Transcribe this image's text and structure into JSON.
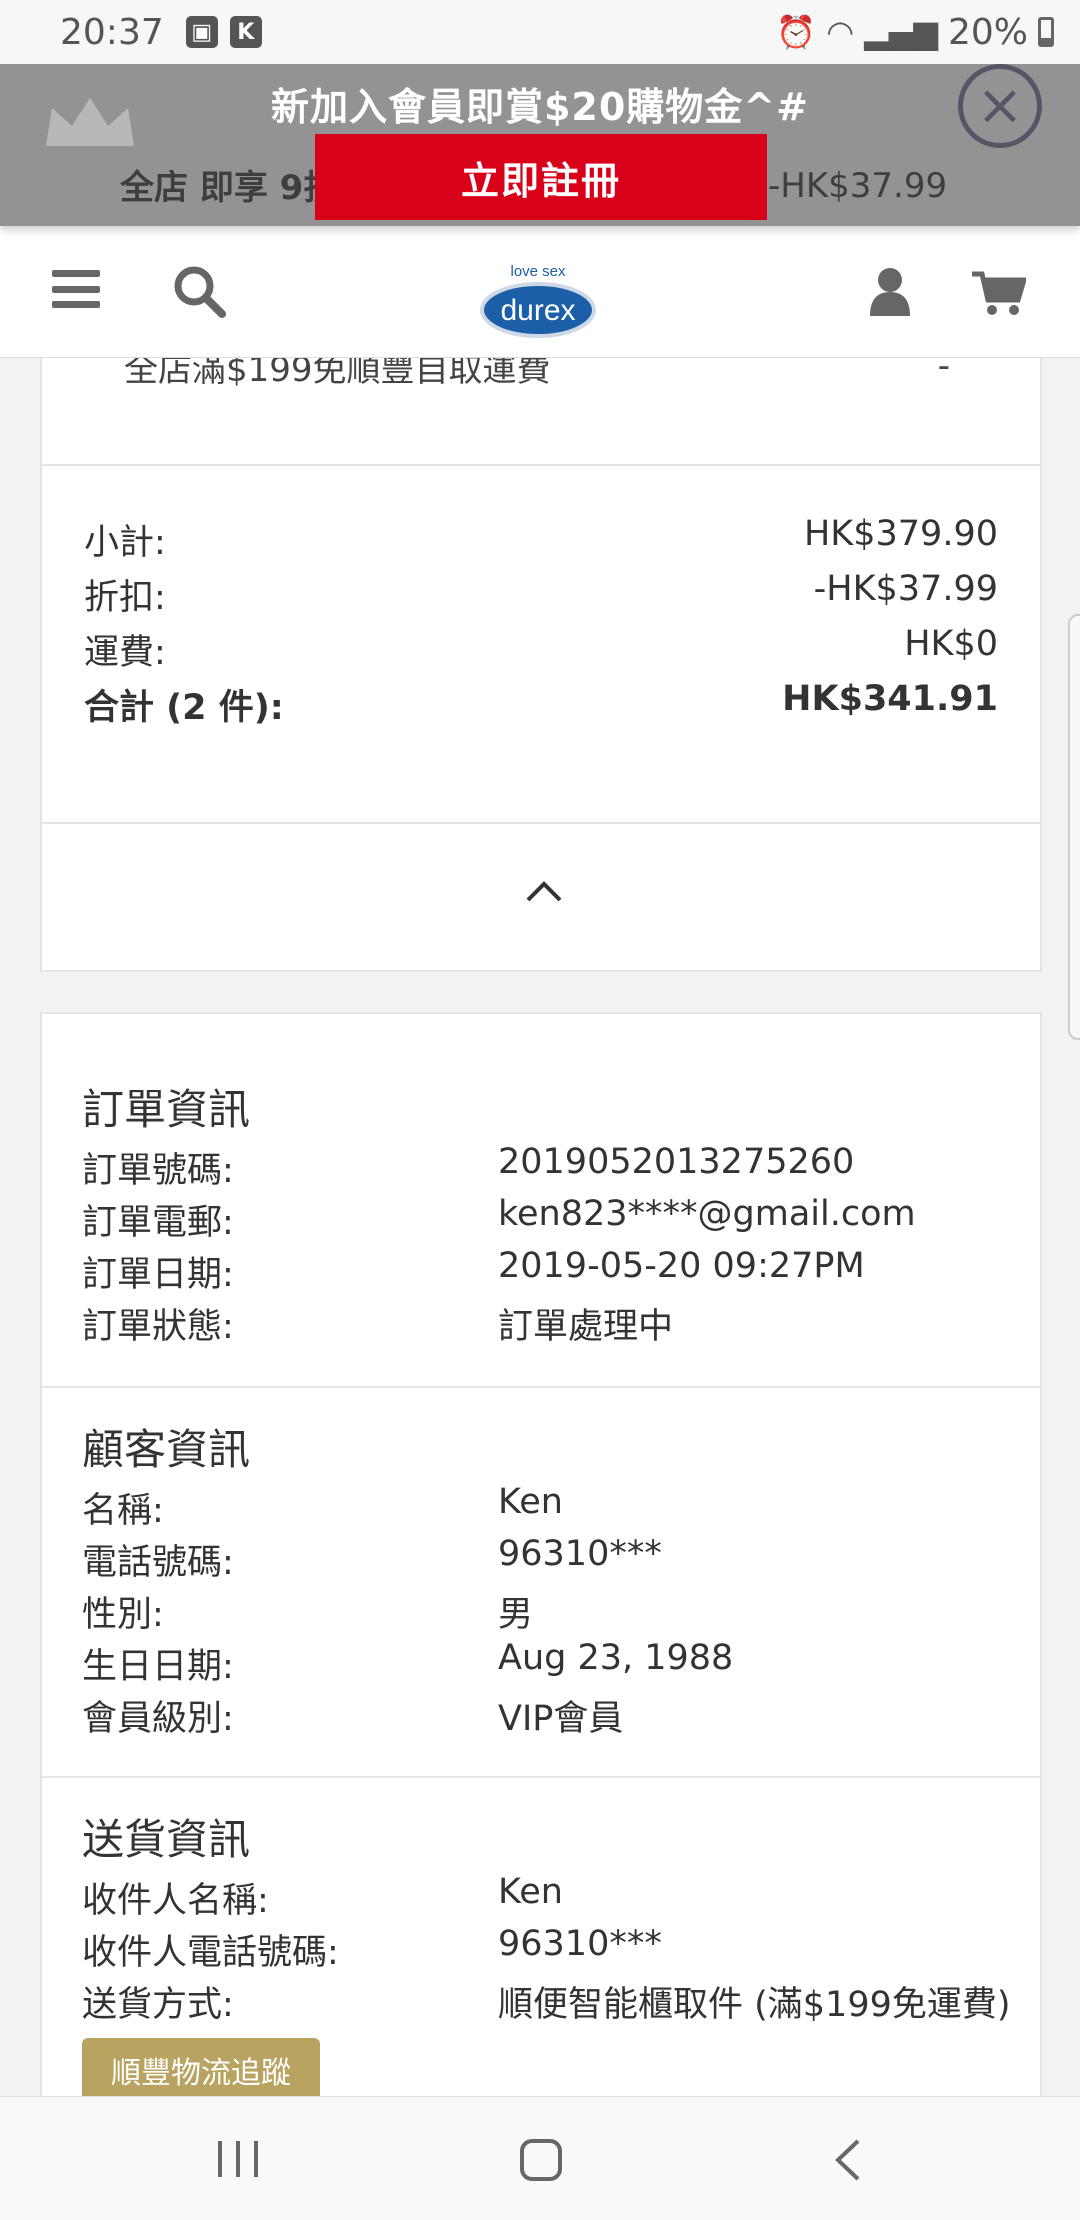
{
  "status_bar": {
    "time": "20:37",
    "battery": "20%",
    "icons": [
      "gallery-icon",
      "k-app-icon",
      "alarm-icon",
      "wifi-icon",
      "signal-icon",
      "battery-icon"
    ]
  },
  "promo": {
    "title": "新加入會員即賞$20購物金^#",
    "button_label": "立即註冊",
    "behind_text_left": "全店 即享 9折",
    "behind_text_right": "-HK$37.99"
  },
  "header": {
    "logo_tagline": "love sex",
    "logo_text": "durex"
  },
  "top_card": {
    "peek_left": "全店滿$199免順豐自取運費",
    "peek_right": "-"
  },
  "summary": {
    "rows": [
      {
        "label": "小計:",
        "value": "HK$379.90"
      },
      {
        "label": "折扣:",
        "value": "-HK$37.99"
      },
      {
        "label": "運費:",
        "value": "HK$0"
      },
      {
        "label": "合計 (2 件):",
        "value": "HK$341.91"
      }
    ]
  },
  "order_info": {
    "title": "訂單資訊",
    "rows": [
      {
        "label": "訂單號碼:",
        "value": "2019052013275260"
      },
      {
        "label": "訂單電郵:",
        "value": "ken823****@gmail.com"
      },
      {
        "label": "訂單日期:",
        "value": "2019-05-20 09:27PM"
      },
      {
        "label": "訂單狀態:",
        "value": "訂單處理中"
      }
    ]
  },
  "customer_info": {
    "title": "顧客資訊",
    "rows": [
      {
        "label": "名稱:",
        "value": "Ken"
      },
      {
        "label": "電話號碼:",
        "value": "96310***"
      },
      {
        "label": "性別:",
        "value": "男"
      },
      {
        "label": "生日日期:",
        "value": "Aug 23, 1988"
      },
      {
        "label": "會員級別:",
        "value": "VIP會員"
      }
    ]
  },
  "delivery_info": {
    "title": "送貨資訊",
    "rows": [
      {
        "label": "收件人名稱:",
        "value": "Ken"
      },
      {
        "label": "收件人電話號碼:",
        "value": "96310***"
      },
      {
        "label": "送貨方式:",
        "value": "順便智能櫃取件 (滿$199免運費)"
      }
    ],
    "track_button": "順豐物流追蹤"
  },
  "colors": {
    "promo_red": "#d90019",
    "track_gold": "#b8a460",
    "durex_blue": "#1b5fa8"
  }
}
